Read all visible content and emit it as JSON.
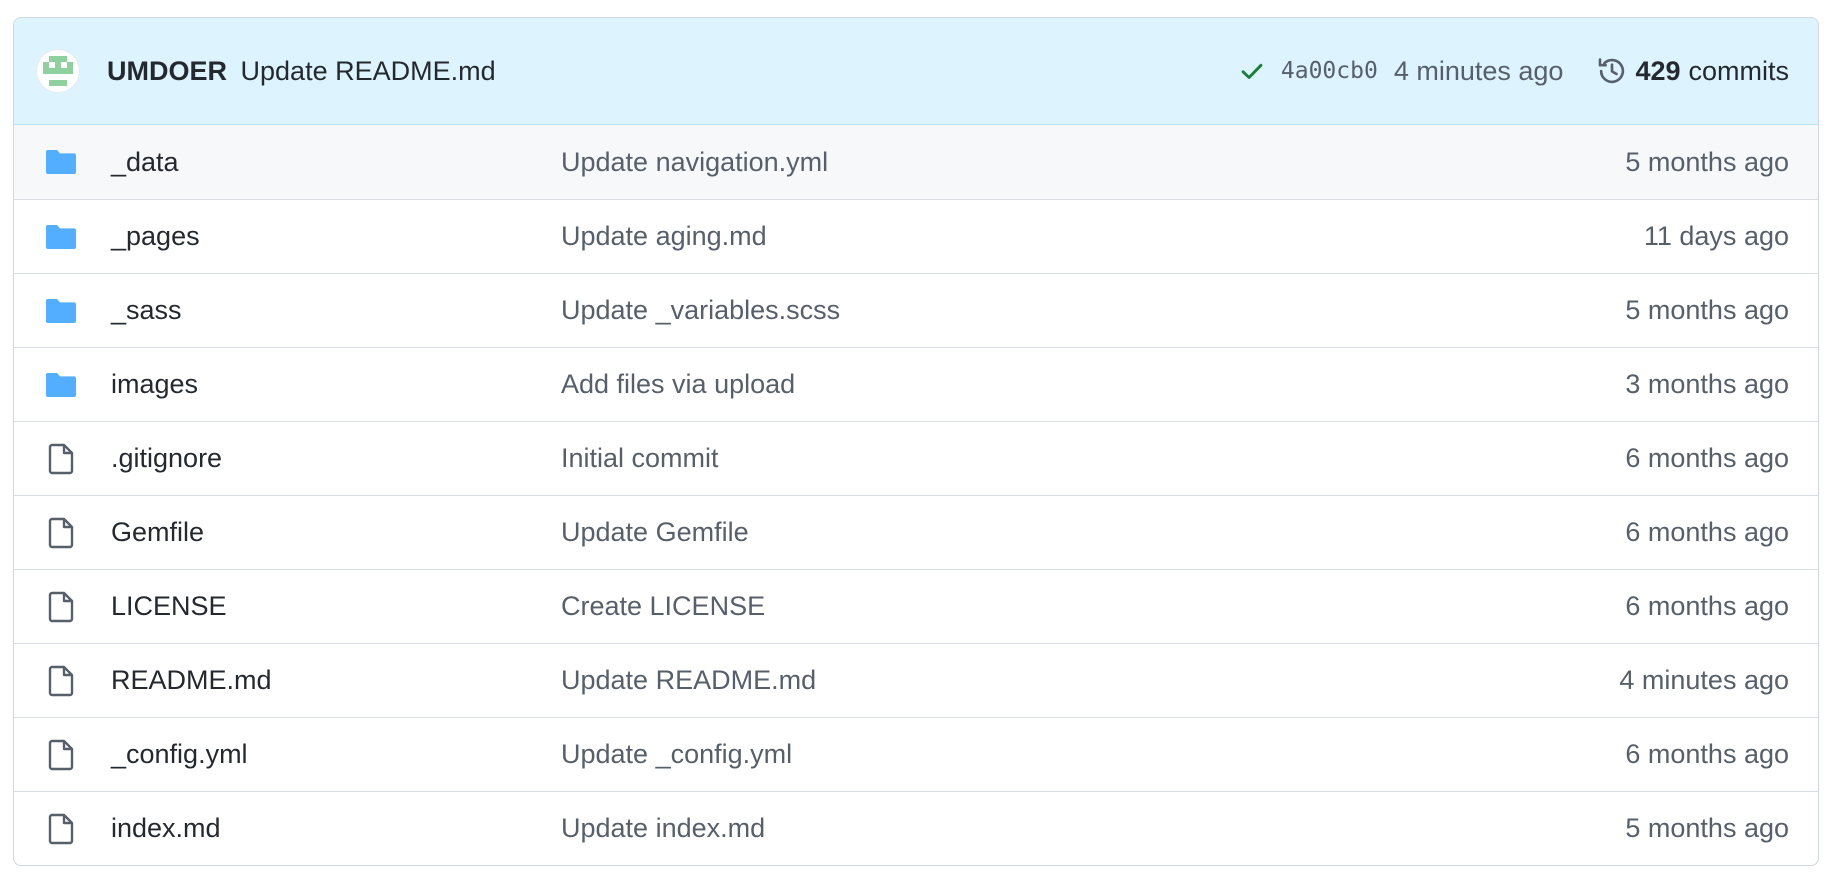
{
  "latest_commit": {
    "author": "UMDOER",
    "message": "Update README.md",
    "sha": "4a00cb0",
    "time": "4 minutes ago",
    "status_icon": "check-icon",
    "status_color": "#1a7f37"
  },
  "history": {
    "count": "429",
    "label": "commits",
    "icon": "history-icon"
  },
  "colors": {
    "header_bg": "#ddf4ff",
    "folder": "#54aeff",
    "file_icon": "#57606a",
    "avatar": "#8fd19e"
  },
  "files": [
    {
      "type": "folder",
      "icon": "folder-icon",
      "name": "_data",
      "message": "Update navigation.yml",
      "age": "5 months ago"
    },
    {
      "type": "folder",
      "icon": "folder-icon",
      "name": "_pages",
      "message": "Update aging.md",
      "age": "11 days ago"
    },
    {
      "type": "folder",
      "icon": "folder-icon",
      "name": "_sass",
      "message": "Update _variables.scss",
      "age": "5 months ago"
    },
    {
      "type": "folder",
      "icon": "folder-icon",
      "name": "images",
      "message": "Add files via upload",
      "age": "3 months ago"
    },
    {
      "type": "file",
      "icon": "file-icon",
      "name": ".gitignore",
      "message": "Initial commit",
      "age": "6 months ago"
    },
    {
      "type": "file",
      "icon": "file-icon",
      "name": "Gemfile",
      "message": "Update Gemfile",
      "age": "6 months ago"
    },
    {
      "type": "file",
      "icon": "file-icon",
      "name": "LICENSE",
      "message": "Create LICENSE",
      "age": "6 months ago"
    },
    {
      "type": "file",
      "icon": "file-icon",
      "name": "README.md",
      "message": "Update README.md",
      "age": "4 minutes ago"
    },
    {
      "type": "file",
      "icon": "file-icon",
      "name": "_config.yml",
      "message": "Update _config.yml",
      "age": "6 months ago"
    },
    {
      "type": "file",
      "icon": "file-icon",
      "name": "index.md",
      "message": "Update index.md",
      "age": "5 months ago"
    }
  ]
}
